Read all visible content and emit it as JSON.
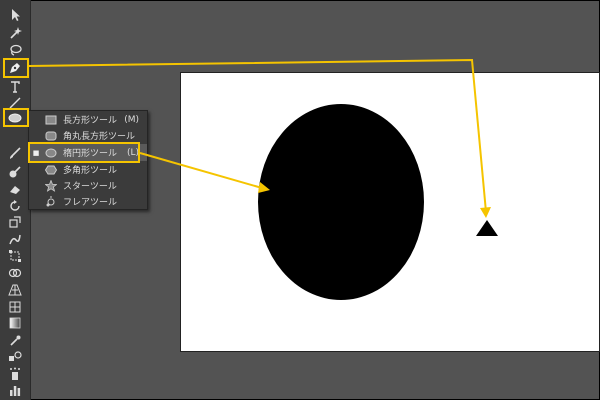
{
  "toolbar": {
    "tools": [
      {
        "name": "selection-tool",
        "icon": "arrow-icon"
      },
      {
        "name": "magic-wand-tool",
        "icon": "magic-wand-icon"
      },
      {
        "name": "lasso-tool",
        "icon": "lasso-icon"
      },
      {
        "name": "pen-tool",
        "icon": "pen-icon"
      },
      {
        "name": "type-tool",
        "icon": "type-icon"
      },
      {
        "name": "line-tool",
        "icon": "line-icon"
      },
      {
        "name": "ellipse-tool",
        "icon": "ellipse-icon"
      },
      {
        "name": "paintbrush-tool",
        "icon": "brush-icon"
      },
      {
        "name": "blob-brush-tool",
        "icon": "blob-icon"
      },
      {
        "name": "eraser-tool",
        "icon": "eraser-icon"
      },
      {
        "name": "rotate-tool",
        "icon": "rotate-icon"
      },
      {
        "name": "scale-tool",
        "icon": "scale-icon"
      },
      {
        "name": "warp-tool",
        "icon": "warp-icon"
      },
      {
        "name": "free-transform-tool",
        "icon": "transform-icon"
      },
      {
        "name": "shape-builder-tool",
        "icon": "shape-builder-icon"
      },
      {
        "name": "perspective-tool",
        "icon": "perspective-icon"
      },
      {
        "name": "mesh-tool",
        "icon": "mesh-icon"
      },
      {
        "name": "gradient-tool",
        "icon": "gradient-icon"
      },
      {
        "name": "eyedropper-tool",
        "icon": "eyedropper-icon"
      },
      {
        "name": "blend-tool",
        "icon": "blend-icon"
      },
      {
        "name": "symbol-sprayer-tool",
        "icon": "sprayer-icon"
      },
      {
        "name": "graph-tool",
        "icon": "graph-icon"
      }
    ]
  },
  "flyout": {
    "items": [
      {
        "label": "長方形ツール",
        "key": "(M)",
        "icon": "rectangle-icon"
      },
      {
        "label": "角丸長方形ツール",
        "key": "",
        "icon": "rounded-rectangle-icon"
      },
      {
        "label": "楕円形ツール",
        "key": "(L)",
        "icon": "ellipse-icon",
        "selected": true
      },
      {
        "label": "多角形ツール",
        "key": "",
        "icon": "polygon-icon"
      },
      {
        "label": "スターツール",
        "key": "",
        "icon": "star-icon"
      },
      {
        "label": "フレアツール",
        "key": "",
        "icon": "flare-icon"
      }
    ]
  },
  "colors": {
    "highlight": "#f5c400",
    "toolbar_bg": "#3c3c3c",
    "workspace_bg": "#535353",
    "artboard": "#ffffff",
    "shape_fill": "#000000"
  }
}
